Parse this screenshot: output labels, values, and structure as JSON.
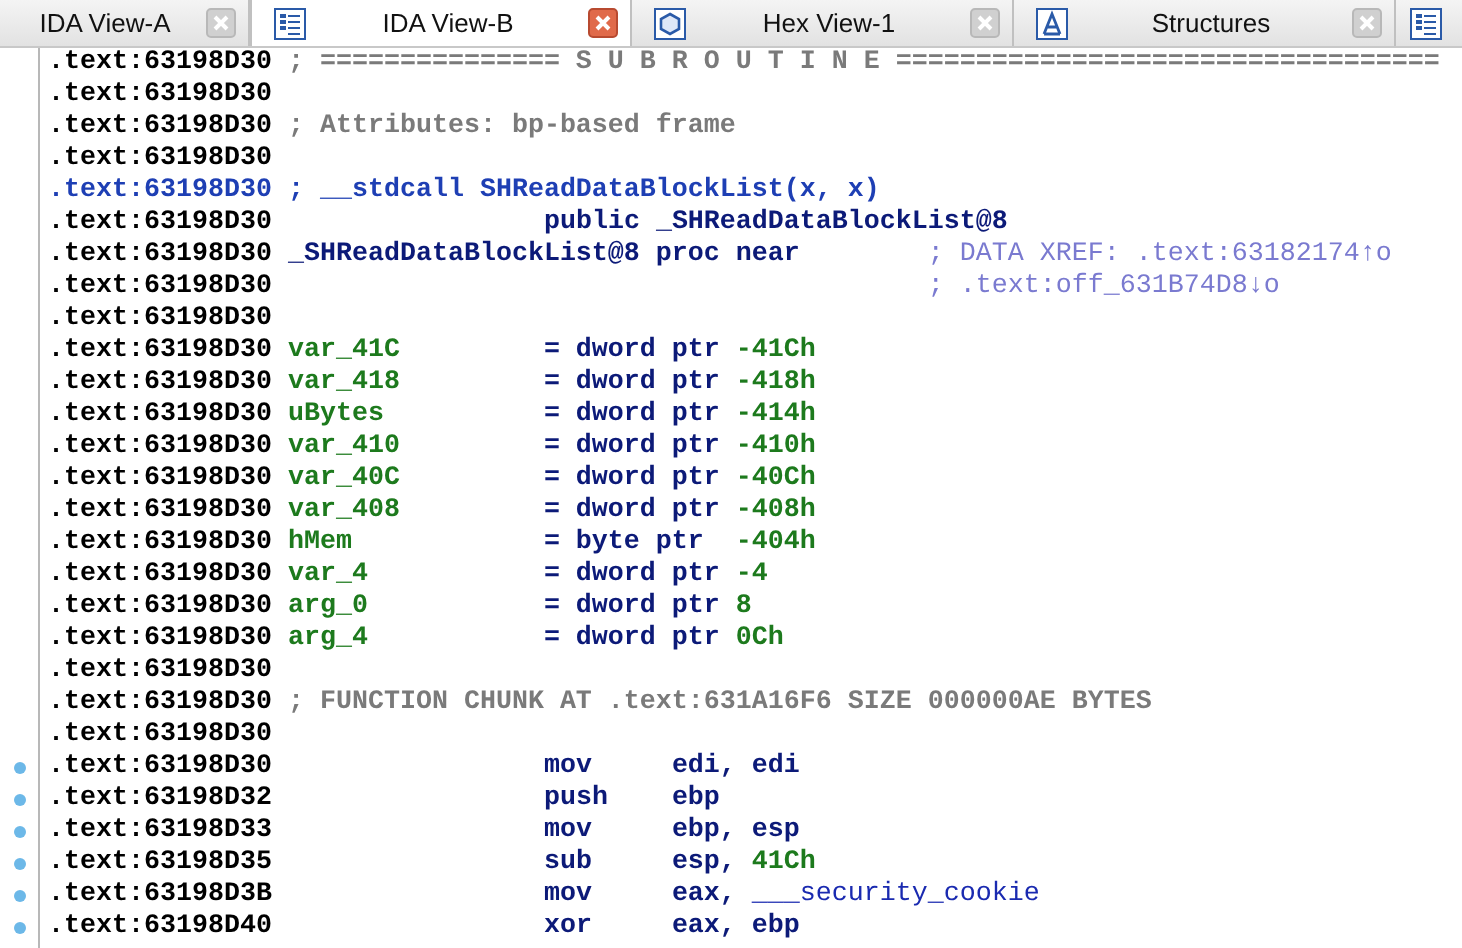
{
  "tabs": [
    {
      "label": "IDA View-A",
      "selected": false,
      "kind": "plain"
    },
    {
      "label": "IDA View-B",
      "selected": true,
      "kind": "listing"
    },
    {
      "label": "Hex View-1",
      "selected": false,
      "kind": "hex"
    },
    {
      "label": "Structures",
      "selected": false,
      "kind": "struct"
    },
    {
      "selected": false,
      "kind": "listing"
    }
  ],
  "lines": [
    {
      "address": ".text:63198D30",
      "current": false,
      "dot": false,
      "kind": "comment",
      "text": "; =============== S U B R O U T I N E =================================="
    },
    {
      "address": ".text:63198D30",
      "current": false,
      "dot": false,
      "kind": "blank"
    },
    {
      "address": ".text:63198D30",
      "current": false,
      "dot": false,
      "kind": "comment",
      "text": "; Attributes: bp-based frame"
    },
    {
      "address": ".text:63198D30",
      "current": false,
      "dot": false,
      "kind": "blank"
    },
    {
      "address": ".text:63198D30",
      "current": true,
      "dot": false,
      "kind": "proto",
      "text": "; __stdcall SHReadDataBlockList(x, x)"
    },
    {
      "address": ".text:63198D30",
      "current": false,
      "dot": false,
      "kind": "directive",
      "text": "public _SHReadDataBlockList@8"
    },
    {
      "address": ".text:63198D30",
      "current": false,
      "dot": false,
      "kind": "proc",
      "name": "_SHReadDataBlockList@8",
      "text": "proc near",
      "xref": "; DATA XREF: .text:63182174↑o"
    },
    {
      "address": ".text:63198D30",
      "current": false,
      "dot": false,
      "kind": "xref",
      "xref": "; .text:off_631B74D8↓o"
    },
    {
      "address": ".text:63198D30",
      "current": false,
      "dot": false,
      "kind": "blank"
    },
    {
      "address": ".text:63198D30",
      "current": false,
      "dot": false,
      "kind": "var",
      "name": "var_41C",
      "op": "=",
      "type": "dword ptr",
      "value": "-41Ch"
    },
    {
      "address": ".text:63198D30",
      "current": false,
      "dot": false,
      "kind": "var",
      "name": "var_418",
      "op": "=",
      "type": "dword ptr",
      "value": "-418h"
    },
    {
      "address": ".text:63198D30",
      "current": false,
      "dot": false,
      "kind": "var",
      "name": "uBytes",
      "op": "=",
      "type": "dword ptr",
      "value": "-414h"
    },
    {
      "address": ".text:63198D30",
      "current": false,
      "dot": false,
      "kind": "var",
      "name": "var_410",
      "op": "=",
      "type": "dword ptr",
      "value": "-410h"
    },
    {
      "address": ".text:63198D30",
      "current": false,
      "dot": false,
      "kind": "var",
      "name": "var_40C",
      "op": "=",
      "type": "dword ptr",
      "value": "-40Ch"
    },
    {
      "address": ".text:63198D30",
      "current": false,
      "dot": false,
      "kind": "var",
      "name": "var_408",
      "op": "=",
      "type": "dword ptr",
      "value": "-408h"
    },
    {
      "address": ".text:63198D30",
      "current": false,
      "dot": false,
      "kind": "var",
      "name": "hMem",
      "op": "=",
      "type": "byte ptr",
      "value": "-404h"
    },
    {
      "address": ".text:63198D30",
      "current": false,
      "dot": false,
      "kind": "var",
      "name": "var_4",
      "op": "=",
      "type": "dword ptr",
      "value": "-4"
    },
    {
      "address": ".text:63198D30",
      "current": false,
      "dot": false,
      "kind": "var",
      "name": "arg_0",
      "op": "=",
      "type": "dword ptr",
      "value": "8"
    },
    {
      "address": ".text:63198D30",
      "current": false,
      "dot": false,
      "kind": "var",
      "name": "arg_4",
      "op": "=",
      "type": "dword ptr",
      "value": "0Ch"
    },
    {
      "address": ".text:63198D30",
      "current": false,
      "dot": false,
      "kind": "blank"
    },
    {
      "address": ".text:63198D30",
      "current": false,
      "dot": false,
      "kind": "comment",
      "text": "; FUNCTION CHUNK AT .text:631A16F6 SIZE 000000AE BYTES"
    },
    {
      "address": ".text:63198D30",
      "current": false,
      "dot": false,
      "kind": "blank"
    },
    {
      "address": ".text:63198D30",
      "current": false,
      "dot": true,
      "kind": "instr",
      "mnemonic": "mov",
      "operands": [
        {
          "kind": "code",
          "text": "edi, edi"
        }
      ]
    },
    {
      "address": ".text:63198D32",
      "current": false,
      "dot": true,
      "kind": "instr",
      "mnemonic": "push",
      "operands": [
        {
          "kind": "code",
          "text": "ebp"
        }
      ]
    },
    {
      "address": ".text:63198D33",
      "current": false,
      "dot": true,
      "kind": "instr",
      "mnemonic": "mov",
      "operands": [
        {
          "kind": "code",
          "text": "ebp, esp"
        }
      ]
    },
    {
      "address": ".text:63198D35",
      "current": false,
      "dot": true,
      "kind": "instr",
      "mnemonic": "sub",
      "operands": [
        {
          "kind": "code",
          "text": "esp,"
        },
        {
          "kind": "num",
          "text": "41Ch"
        }
      ]
    },
    {
      "address": ".text:63198D3B",
      "current": false,
      "dot": true,
      "kind": "instr",
      "mnemonic": "mov",
      "operands": [
        {
          "kind": "code",
          "text": "eax,"
        },
        {
          "kind": "symbol",
          "text": "___security_cookie"
        }
      ]
    },
    {
      "address": ".text:63198D40",
      "current": false,
      "dot": true,
      "kind": "instr",
      "mnemonic": "xor",
      "operands": [
        {
          "kind": "code",
          "text": "eax, ebp"
        }
      ]
    }
  ]
}
